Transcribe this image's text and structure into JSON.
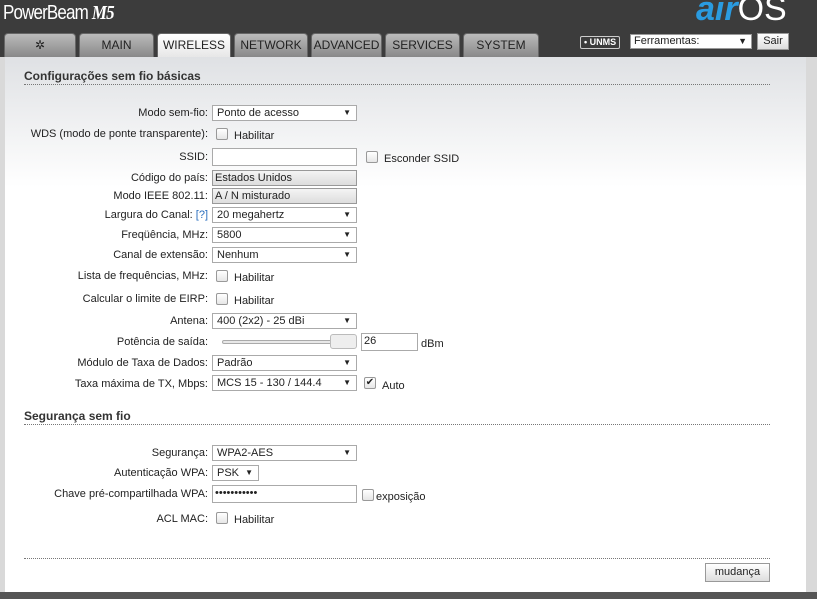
{
  "header": {
    "product": "PowerBeam",
    "model": "M5",
    "brand_air": "air",
    "brand_os": "OS"
  },
  "tabs": [
    {
      "label": ""
    },
    {
      "label": "MAIN"
    },
    {
      "label": "WIRELESS"
    },
    {
      "label": "NETWORK"
    },
    {
      "label": "ADVANCED"
    },
    {
      "label": "SERVICES"
    },
    {
      "label": "SYSTEM"
    }
  ],
  "topbar": {
    "unms": "• UNMS",
    "tools": "Ferramentas:",
    "logout": "Sair"
  },
  "basic": {
    "title": "Configurações sem fio básicas",
    "mode_label": "Modo sem-fio:",
    "mode": "Ponto de acesso",
    "wds_label": "WDS (modo de ponte transparente):",
    "enable": "Habilitar",
    "ssid_label": "SSID:",
    "ssid": "",
    "hide_ssid": "Esconder SSID",
    "country_label": "Código do país:",
    "country": "Estados Unidos",
    "ieee_label": "Modo IEEE 802.11:",
    "ieee": "A / N misturado",
    "width_label": "Largura do Canal:",
    "help": "[?]",
    "width": "20 megahertz",
    "freq_label": "Freqüência, MHz:",
    "freq": "5800",
    "ext_label": "Canal de extensão:",
    "ext": "Nenhum",
    "freqlist_label": "Lista de frequências, MHz:",
    "eirp_label": "Calcular o limite de EIRP:",
    "antenna_label": "Antena:",
    "antenna": "400 (2x2) - 25 dBi",
    "power_label": "Potência de saída:",
    "power": "26",
    "power_unit": "dBm",
    "power_fraction": 1.0,
    "rate_module_label": "Módulo de Taxa de Dados:",
    "rate_module": "Padrão",
    "maxrate_label": "Taxa máxima de TX, Mbps:",
    "maxrate": "MCS 15 - 130 / 144.4",
    "auto": "Auto"
  },
  "security": {
    "title": "Segurança sem fio",
    "sec_label": "Segurança:",
    "sec": "WPA2-AES",
    "auth_label": "Autenticação WPA:",
    "auth": "PSK",
    "key_label": "Chave pré-compartilhada WPA:",
    "key": "•••••••••••",
    "show": "exposição",
    "acl_label": "ACL MAC:",
    "enable": "Habilitar"
  },
  "footer": {
    "change": "mudança"
  }
}
